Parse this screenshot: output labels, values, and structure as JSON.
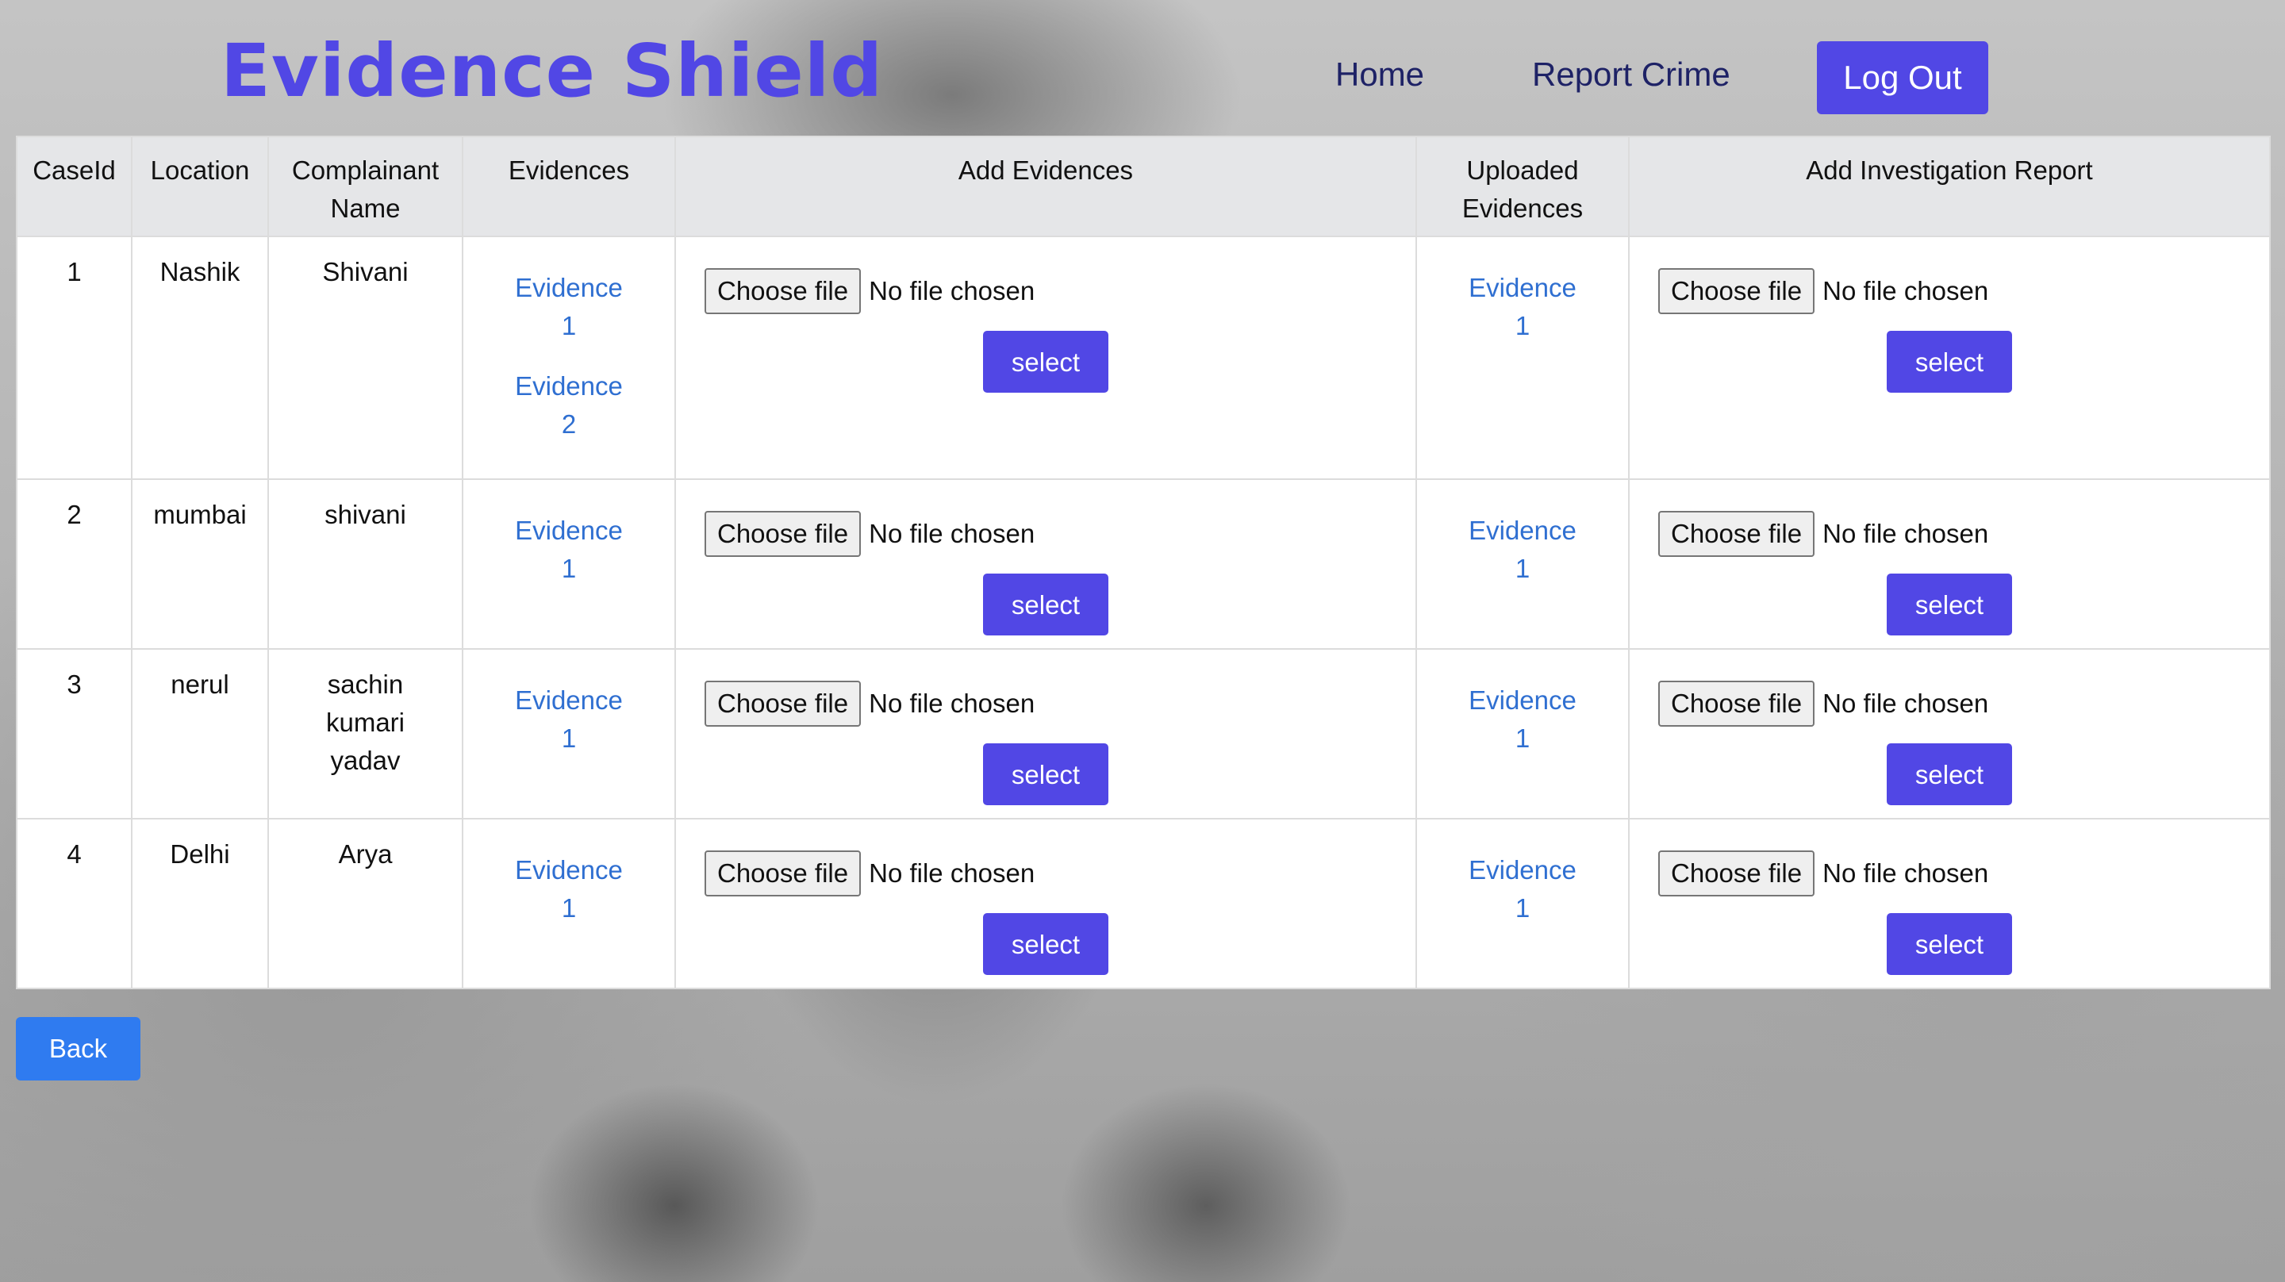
{
  "brand": "Evidence Shield",
  "nav": {
    "home": "Home",
    "report_crime": "Report Crime",
    "logout": "Log Out"
  },
  "table": {
    "headers": [
      "CaseId",
      "Location",
      "Complainant Name",
      "Evidences",
      "Add Evidences",
      "Uploaded Evidences",
      "Add Investigation Report"
    ],
    "rows": [
      {
        "case_id": "1",
        "location": "Nashik",
        "complainant": "Shivani",
        "evidences": [
          "Evidence 1",
          "Evidence 2"
        ],
        "uploaded": [
          "Evidence 1"
        ]
      },
      {
        "case_id": "2",
        "location": "mumbai",
        "complainant": "shivani",
        "evidences": [
          "Evidence 1"
        ],
        "uploaded": [
          "Evidence 1"
        ]
      },
      {
        "case_id": "3",
        "location": "nerul",
        "complainant": "sachin kumari yadav",
        "evidences": [
          "Evidence 1"
        ],
        "uploaded": [
          "Evidence 1"
        ]
      },
      {
        "case_id": "4",
        "location": "Delhi",
        "complainant": "Arya",
        "evidences": [
          "Evidence 1"
        ],
        "uploaded": [
          "Evidence 1"
        ]
      }
    ],
    "choose_file_label": "Choose file",
    "no_file_text": "No file chosen",
    "select_label": "select"
  },
  "back_label": "Back",
  "colors": {
    "brand": "#5147e5",
    "primary_button": "#5147e5",
    "back_button": "#2f7bf0",
    "link": "#2f6fd1",
    "nav_text": "#1e2266"
  }
}
